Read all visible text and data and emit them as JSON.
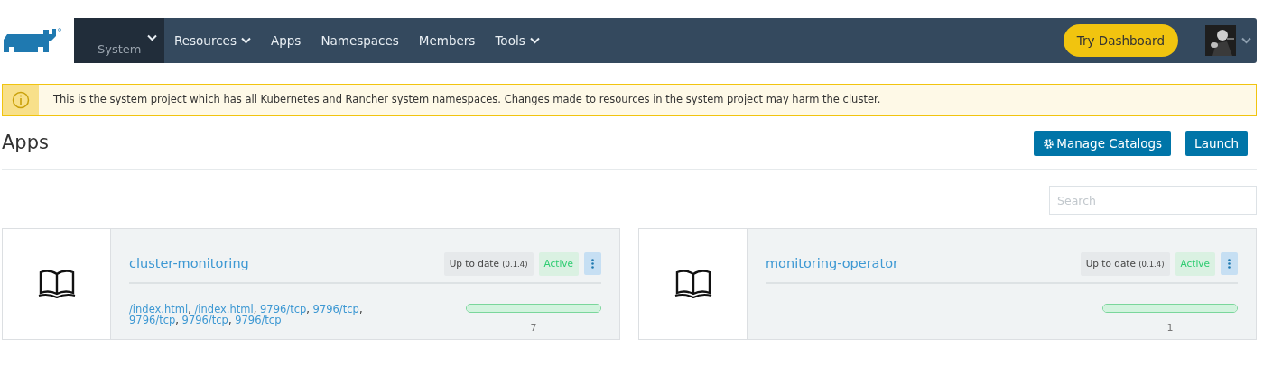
{
  "navbar": {
    "project": {
      "label": "System",
      "expanded": false
    },
    "items": [
      {
        "label": "Resources",
        "dropdown": true
      },
      {
        "label": "Apps",
        "dropdown": false
      },
      {
        "label": "Namespaces",
        "dropdown": false
      },
      {
        "label": "Members",
        "dropdown": false
      },
      {
        "label": "Tools",
        "dropdown": true
      }
    ],
    "try_button": "Try Dashboard"
  },
  "alert": {
    "text": "This is the system project which has all Kubernetes and Rancher system namespaces. Changes made to resources in the system project may harm the cluster."
  },
  "page": {
    "title": "Apps",
    "buttons": [
      {
        "label": "Manage Catalogs",
        "kind": "gear"
      },
      {
        "label": "Launch",
        "kind": "plain"
      }
    ]
  },
  "search": {
    "placeholder": "Search"
  },
  "apps": [
    {
      "name": "cluster-monitoring",
      "version_status": "Up to date",
      "version": "(0.1.4)",
      "state": "Active",
      "endpoints": [
        {
          "label": "/index.html",
          "separator": ","
        },
        {
          "label": "/index.html",
          "separator": ","
        },
        {
          "label": "9796/tcp",
          "separator": ","
        },
        {
          "label": "9796/tcp",
          "separator": ","
        },
        {
          "label": "9796/tcp",
          "separator": ","
        },
        {
          "label": "9796/tcp",
          "separator": ","
        },
        {
          "label": "9796/tcp"
        }
      ],
      "level": 1,
      "count": "7"
    },
    {
      "name": "monitoring-operator",
      "version_status": "Up to date",
      "version": "(0.1.4)",
      "state": "Active",
      "level": 1,
      "count": "1"
    }
  ]
}
